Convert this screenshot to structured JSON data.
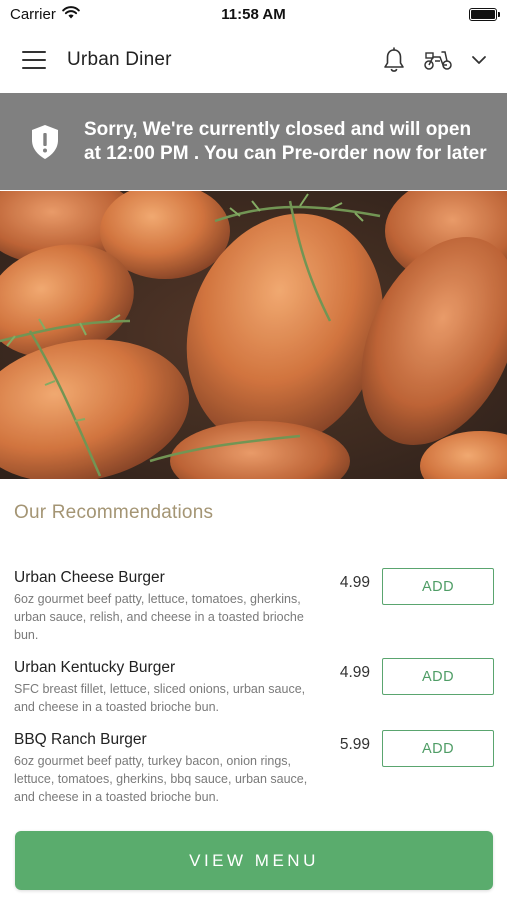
{
  "status_bar": {
    "carrier": "Carrier",
    "time": "11:58 AM",
    "icons": [
      "wifi-icon",
      "battery-icon"
    ]
  },
  "header": {
    "title": "Urban Diner",
    "icons": [
      "menu-icon",
      "bell-icon",
      "delivery-scooter-icon",
      "chevron-down-icon"
    ]
  },
  "closed_banner": {
    "message": "Sorry, We're currently closed and will open at 12:00 PM . You can Pre-order now for later",
    "icon": "shield-alert-icon",
    "background": "#808080"
  },
  "hero": {
    "image": "chicken-wings-with-rosemary"
  },
  "recommendations": {
    "title": "Our Recommendations",
    "items": [
      {
        "name": "Urban Cheese Burger",
        "description": "6oz gourmet beef patty, lettuce, tomatoes, gherkins, urban sauce, relish, and cheese in a toasted brioche bun.",
        "price": "4.99",
        "button": "ADD"
      },
      {
        "name": "Urban Kentucky Burger",
        "description": "SFC breast fillet, lettuce, sliced onions, urban sauce, and cheese in a toasted brioche bun.",
        "price": "4.99",
        "button": "ADD"
      },
      {
        "name": "BBQ Ranch Burger",
        "description": "6oz gourmet beef patty, turkey bacon, onion rings, lettuce, tomatoes, gherkins, bbq sauce, urban sauce, and cheese in a toasted brioche bun.",
        "price": "5.99",
        "button": "ADD"
      }
    ]
  },
  "footer": {
    "view_menu_label": "VIEW MENU"
  },
  "colors": {
    "accent_green": "#5aac6d",
    "section_title": "#a49574",
    "banner_gray": "#808080"
  }
}
